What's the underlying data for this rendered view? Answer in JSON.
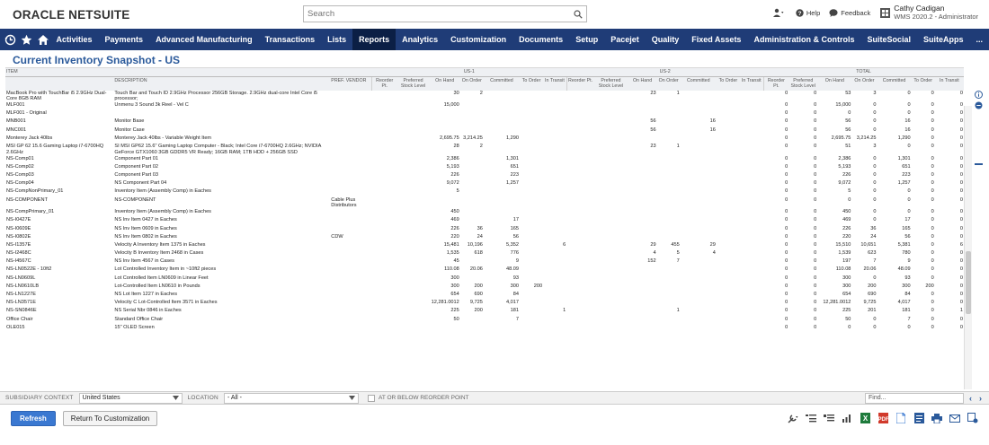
{
  "brand": {
    "oracle": "ORACLE",
    "netsuite": "NETSUITE"
  },
  "search": {
    "placeholder": "Search"
  },
  "topright": {
    "help": "Help",
    "feedback": "Feedback",
    "user_name": "Cathy Cadigan",
    "user_role": "WMS 2020.2 - Administrator"
  },
  "nav": {
    "items": [
      "Activities",
      "Payments",
      "Advanced Manufacturing",
      "Transactions",
      "Lists",
      "Reports",
      "Analytics",
      "Customization",
      "Documents",
      "Setup",
      "Pacejet",
      "Quality",
      "Fixed Assets",
      "Administration & Controls",
      "SuiteSocial",
      "SuiteApps",
      "..."
    ],
    "active": "Reports"
  },
  "page": {
    "title": "Current Inventory Snapshot - US"
  },
  "table": {
    "group_headers": {
      "item": "ITEM",
      "us1": "US-1",
      "us2": "US-2",
      "total": "TOTAL"
    },
    "col_headers": {
      "description": "DESCRIPTION",
      "pref_vendor": "PREF. VENDOR",
      "reorder": "Reorder Pt.",
      "preferred": "Preferred Stock Level",
      "on_hand": "On Hand",
      "on_order": "On Order",
      "committed": "Committed",
      "to_order": "To Order",
      "in_transit": "In Transit"
    },
    "rows": [
      {
        "item": "MacBook Pro with TouchBar i5 2.9GHz Dual-Core 8GB RAM",
        "desc": "Touch Bar and Touch ID 2.9GHz Processor 256GB Storage. 2.9GHz dual-core Intel Core i5 processor;",
        "vendor": "",
        "u1": [
          "",
          "",
          "30",
          "2",
          "",
          "",
          ""
        ],
        "u2": [
          "",
          "",
          "23",
          "1",
          "",
          "",
          ""
        ],
        "t": [
          "0",
          "0",
          "53",
          "3",
          "0",
          "0",
          "0"
        ]
      },
      {
        "item": "MLF001",
        "desc": "Unmenu 3 Sound 3k Reel - Vel C",
        "vendor": "",
        "u1": [
          "",
          "",
          "15,000",
          "",
          "",
          "",
          ""
        ],
        "u2": [
          "",
          "",
          "",
          "",
          "",
          "",
          ""
        ],
        "t": [
          "0",
          "0",
          "15,000",
          "0",
          "0",
          "0",
          "0"
        ]
      },
      {
        "item": "MLF001 - Original",
        "desc": "",
        "vendor": "",
        "u1": [
          "",
          "",
          "",
          "",
          "",
          "",
          ""
        ],
        "u2": [
          "",
          "",
          "",
          "",
          "",
          "",
          ""
        ],
        "t": [
          "0",
          "0",
          "0",
          "0",
          "0",
          "0",
          "0"
        ]
      },
      {
        "item": "MNB001",
        "desc": "Monitor Base",
        "vendor": "",
        "u1": [
          "",
          "",
          "",
          "",
          "",
          "",
          ""
        ],
        "u2": [
          "",
          "",
          "56",
          "",
          "16",
          "",
          ""
        ],
        "t": [
          "0",
          "0",
          "56",
          "0",
          "16",
          "0",
          "0"
        ]
      },
      {
        "item": "MNC001",
        "desc": "Monitor Case",
        "vendor": "",
        "u1": [
          "",
          "",
          "",
          "",
          "",
          "",
          ""
        ],
        "u2": [
          "",
          "",
          "56",
          "",
          "16",
          "",
          ""
        ],
        "t": [
          "0",
          "0",
          "56",
          "0",
          "16",
          "0",
          "0"
        ]
      },
      {
        "item": "Monterey Jack 40lbs",
        "desc": "Monterey Jack 40lbs - Variable Weight Item",
        "vendor": "",
        "u1": [
          "",
          "",
          "2,695.75",
          "3,214.25",
          "1,290",
          "",
          ""
        ],
        "u2": [
          "",
          "",
          "",
          "",
          "",
          "",
          ""
        ],
        "t": [
          "0",
          "0",
          "2,695.75",
          "3,214.25",
          "1,290",
          "0",
          "0"
        ]
      },
      {
        "item": "MSI GP 62 15.6 Gaming Laptop i7-6700HQ 2.6GHz",
        "desc": "SI MSI GP62 15.6\" Gaming Laptop Computer - Black; Intel Core i7-6700HQ 2.6GHz; NVIDIA GeForce GTX1060 3GB GDDR5 VR Ready; 16GB RAM; 1TB HDD + 256GB SSD",
        "vendor": "",
        "u1": [
          "",
          "",
          "28",
          "2",
          "",
          "",
          ""
        ],
        "u2": [
          "",
          "",
          "23",
          "1",
          "",
          "",
          ""
        ],
        "t": [
          "0",
          "0",
          "51",
          "3",
          "0",
          "0",
          "0"
        ]
      },
      {
        "item": "NS-Comp01",
        "desc": "Component Part 01",
        "vendor": "",
        "u1": [
          "",
          "",
          "2,386",
          "",
          "1,301",
          "",
          ""
        ],
        "u2": [
          "",
          "",
          "",
          "",
          "",
          "",
          ""
        ],
        "t": [
          "0",
          "0",
          "2,386",
          "0",
          "1,301",
          "0",
          "0"
        ]
      },
      {
        "item": "NS-Comp02",
        "desc": "Component Part 02",
        "vendor": "",
        "u1": [
          "",
          "",
          "5,193",
          "",
          "651",
          "",
          ""
        ],
        "u2": [
          "",
          "",
          "",
          "",
          "",
          "",
          ""
        ],
        "t": [
          "0",
          "0",
          "5,193",
          "0",
          "651",
          "0",
          "0"
        ]
      },
      {
        "item": "NS-Comp03",
        "desc": "Component Part 03",
        "vendor": "",
        "u1": [
          "",
          "",
          "226",
          "",
          "223",
          "",
          ""
        ],
        "u2": [
          "",
          "",
          "",
          "",
          "",
          "",
          ""
        ],
        "t": [
          "0",
          "0",
          "226",
          "0",
          "223",
          "0",
          "0"
        ]
      },
      {
        "item": "NS-Comp04",
        "desc": "NS Component Part 04",
        "vendor": "",
        "u1": [
          "",
          "",
          "9,072",
          "",
          "1,257",
          "",
          ""
        ],
        "u2": [
          "",
          "",
          "",
          "",
          "",
          "",
          ""
        ],
        "t": [
          "0",
          "0",
          "9,072",
          "0",
          "1,257",
          "0",
          "0"
        ]
      },
      {
        "item": "NS-CompNonPrimary_01",
        "desc": "Inventory Item (Assembly Comp) in Eaches",
        "vendor": "",
        "u1": [
          "",
          "",
          "5",
          "",
          "",
          "",
          ""
        ],
        "u2": [
          "",
          "",
          "",
          "",
          "",
          "",
          ""
        ],
        "t": [
          "0",
          "0",
          "5",
          "0",
          "0",
          "0",
          "0"
        ]
      },
      {
        "item": "NS-COMPONENT",
        "desc": "NS-COMPONENT",
        "vendor": "Cable Plus Distributors",
        "u1": [
          "",
          "",
          "",
          "",
          "",
          "",
          ""
        ],
        "u2": [
          "",
          "",
          "",
          "",
          "",
          "",
          ""
        ],
        "t": [
          "0",
          "0",
          "0",
          "0",
          "0",
          "0",
          "0"
        ]
      },
      {
        "item": "NS-CompPrimary_01",
        "desc": "Inventory Item (Assembly Comp) in Eaches",
        "vendor": "",
        "u1": [
          "",
          "",
          "450",
          "",
          "",
          "",
          ""
        ],
        "u2": [
          "",
          "",
          "",
          "",
          "",
          "",
          ""
        ],
        "t": [
          "0",
          "0",
          "450",
          "0",
          "0",
          "0",
          "0"
        ]
      },
      {
        "item": "NS-I0427E",
        "desc": "NS Inv Item 0427 in Eaches",
        "vendor": "",
        "u1": [
          "",
          "",
          "469",
          "",
          "17",
          "",
          ""
        ],
        "u2": [
          "",
          "",
          "",
          "",
          "",
          "",
          ""
        ],
        "t": [
          "0",
          "0",
          "469",
          "0",
          "17",
          "0",
          "0"
        ]
      },
      {
        "item": "NS-I0609E",
        "desc": "NS Inv Item 0609 in Eaches",
        "vendor": "",
        "u1": [
          "",
          "",
          "226",
          "36",
          "165",
          "",
          ""
        ],
        "u2": [
          "",
          "",
          "",
          "",
          "",
          "",
          ""
        ],
        "t": [
          "0",
          "0",
          "226",
          "36",
          "165",
          "0",
          "0"
        ]
      },
      {
        "item": "NS-I0802E",
        "desc": "NS Inv Item 0802 in Eaches",
        "vendor": "CDW",
        "u1": [
          "",
          "",
          "220",
          "24",
          "56",
          "",
          ""
        ],
        "u2": [
          "",
          "",
          "",
          "",
          "",
          "",
          ""
        ],
        "t": [
          "0",
          "0",
          "220",
          "24",
          "56",
          "0",
          "0"
        ]
      },
      {
        "item": "NS-I1357E",
        "desc": "Velocity A Inventory Item 1375 in Eaches",
        "vendor": "",
        "u1": [
          "",
          "",
          "15,481",
          "10,196",
          "5,352",
          "",
          "6"
        ],
        "u2": [
          "",
          "",
          "29",
          "455",
          "29",
          "",
          ""
        ],
        "t": [
          "0",
          "0",
          "15,510",
          "10,651",
          "5,381",
          "0",
          "6"
        ]
      },
      {
        "item": "NS-I2468C",
        "desc": "Velocity B Inventory Item 2468 in Cases",
        "vendor": "",
        "u1": [
          "",
          "",
          "1,535",
          "618",
          "776",
          "",
          ""
        ],
        "u2": [
          "",
          "",
          "4",
          "5",
          "4",
          "",
          ""
        ],
        "t": [
          "0",
          "0",
          "1,539",
          "623",
          "780",
          "0",
          "0"
        ]
      },
      {
        "item": "NS-I4567C",
        "desc": "NS Inv Item 4567 in Cases",
        "vendor": "",
        "u1": [
          "",
          "",
          "45",
          "",
          "9",
          "",
          ""
        ],
        "u2": [
          "",
          "",
          "152",
          "7",
          "",
          "",
          ""
        ],
        "t": [
          "0",
          "0",
          "197",
          "7",
          "9",
          "0",
          "0"
        ]
      },
      {
        "item": "NS-LN0522E - 10ft2",
        "desc": "Lot Controlled Inventory Item in ~10ft2 pieces",
        "vendor": "",
        "u1": [
          "",
          "",
          "110.08",
          "20.06",
          "48.09",
          "",
          ""
        ],
        "u2": [
          "",
          "",
          "",
          "",
          "",
          "",
          ""
        ],
        "t": [
          "0",
          "0",
          "110.08",
          "20.06",
          "48.09",
          "0",
          "0"
        ]
      },
      {
        "item": "NS-LN0609L",
        "desc": "Lot Controlled Item LN0609 in Linear Feet",
        "vendor": "",
        "u1": [
          "",
          "",
          "300",
          "",
          "93",
          "",
          ""
        ],
        "u2": [
          "",
          "",
          "",
          "",
          "",
          "",
          ""
        ],
        "t": [
          "0",
          "0",
          "300",
          "0",
          "93",
          "0",
          "0"
        ]
      },
      {
        "item": "NS-LN0610LB",
        "desc": "Lot-Controlled Item LN0610 in Pounds",
        "vendor": "",
        "u1": [
          "",
          "",
          "300",
          "200",
          "300",
          "200",
          ""
        ],
        "u2": [
          "",
          "",
          "",
          "",
          "",
          "",
          ""
        ],
        "t": [
          "0",
          "0",
          "300",
          "200",
          "300",
          "200",
          "0"
        ]
      },
      {
        "item": "NS-LN1227E",
        "desc": "NS Lot Item 1227 in Eaches",
        "vendor": "",
        "u1": [
          "",
          "",
          "654",
          "690",
          "84",
          "",
          ""
        ],
        "u2": [
          "",
          "",
          "",
          "",
          "",
          "",
          ""
        ],
        "t": [
          "0",
          "0",
          "654",
          "690",
          "84",
          "0",
          "0"
        ]
      },
      {
        "item": "NS-LN3571E",
        "desc": "Velocity C Lot-Controlled Item 3571 in Eaches",
        "vendor": "",
        "u1": [
          "",
          "",
          "12,281.0012",
          "9,725",
          "4,017",
          "",
          ""
        ],
        "u2": [
          "",
          "",
          "",
          "",
          "",
          "",
          ""
        ],
        "t": [
          "0",
          "0",
          "12,281.0012",
          "9,725",
          "4,017",
          "0",
          "0"
        ]
      },
      {
        "item": "NS-SN0846E",
        "desc": "NS Serial Nbr 0846 in Eaches",
        "vendor": "",
        "u1": [
          "",
          "",
          "225",
          "200",
          "181",
          "",
          "1"
        ],
        "u2": [
          "",
          "",
          "",
          "1",
          "",
          "",
          ""
        ],
        "t": [
          "0",
          "0",
          "225",
          "201",
          "181",
          "0",
          "1"
        ]
      },
      {
        "item": "Office Chair",
        "desc": "Standard Office Chair",
        "vendor": "",
        "u1": [
          "",
          "",
          "50",
          "",
          "7",
          "",
          ""
        ],
        "u2": [
          "",
          "",
          "",
          "",
          "",
          "",
          ""
        ],
        "t": [
          "0",
          "0",
          "50",
          "0",
          "7",
          "0",
          "0"
        ]
      },
      {
        "item": "OLE015",
        "desc": "15\" OLED Screen",
        "vendor": "",
        "u1": [
          "",
          "",
          "",
          "",
          "",
          "",
          ""
        ],
        "u2": [
          "",
          "",
          "",
          "",
          "",
          "",
          ""
        ],
        "t": [
          "0",
          "0",
          "0",
          "0",
          "0",
          "0",
          "0"
        ]
      }
    ]
  },
  "filters": {
    "subsidiary_label": "SUBSIDIARY CONTEXT",
    "subsidiary_value": "United States",
    "location_label": "LOCATION",
    "location_value": "- All -",
    "reorder_label": "AT OR BELOW REORDER POINT",
    "find_placeholder": "Find..."
  },
  "buttons": {
    "refresh": "Refresh",
    "return": "Return To Customization"
  },
  "colors": {
    "nav_bg": "#1f3c77",
    "nav_active": "#0b1f45",
    "title": "#2b5a9b",
    "primary_button": "#3a78d1"
  }
}
